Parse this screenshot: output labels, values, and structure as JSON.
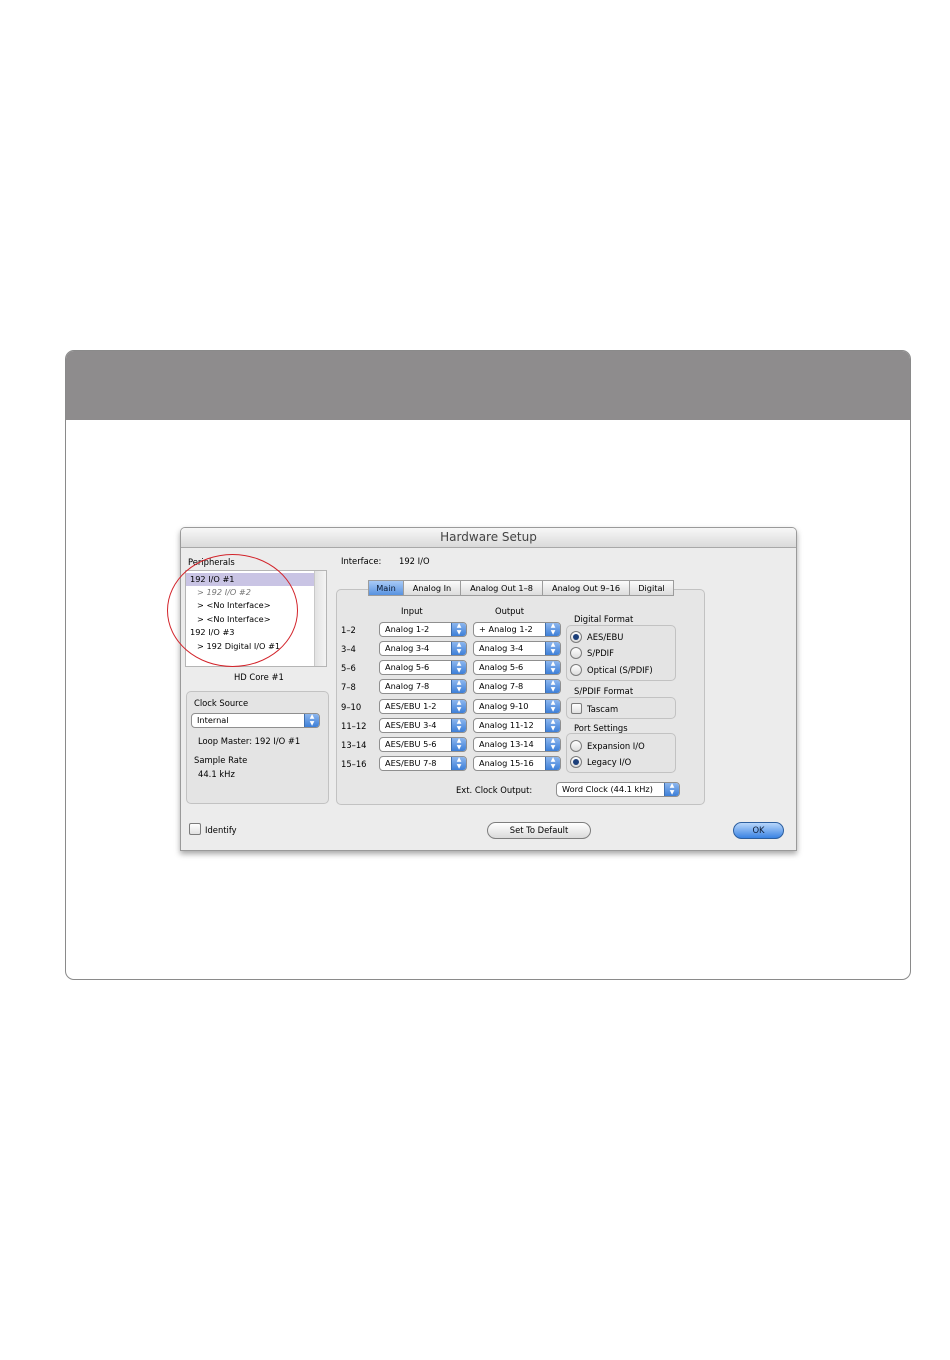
{
  "window": {
    "title": "Hardware Setup"
  },
  "peripherals": {
    "label": "Peripherals",
    "items": [
      {
        "label": "192 I/O #1"
      },
      {
        "label": "> 192 I/O #2"
      },
      {
        "label": "> <No Interface>"
      },
      {
        "label": "> <No Interface>"
      },
      {
        "label": "192 I/O #3"
      },
      {
        "label": "> 192 Digital I/O #1"
      }
    ],
    "core_label": "HD Core #1"
  },
  "clock": {
    "label": "Clock Source",
    "source_value": "Internal",
    "loop_master": "Loop Master: 192 I/O #1",
    "sample_rate_label": "Sample Rate",
    "sample_rate_value": "44.1 kHz"
  },
  "interface": {
    "label": "Interface:",
    "value": "192 I/O"
  },
  "tabs": [
    {
      "label": "Main"
    },
    {
      "label": "Analog In"
    },
    {
      "label": "Analog Out 1–8"
    },
    {
      "label": "Analog Out 9–16"
    },
    {
      "label": "Digital"
    }
  ],
  "io": {
    "input_header": "Input",
    "output_header": "Output",
    "rows": [
      {
        "channel": "1–2",
        "input": "Analog 1-2",
        "output": "+ Analog 1-2"
      },
      {
        "channel": "3–4",
        "input": "Analog 3-4",
        "output": "Analog 3-4"
      },
      {
        "channel": "5–6",
        "input": "Analog 5-6",
        "output": "Analog 5-6"
      },
      {
        "channel": "7–8",
        "input": "Analog 7-8",
        "output": "Analog 7-8"
      },
      {
        "channel": "9–10",
        "input": "AES/EBU 1-2",
        "output": "Analog 9-10"
      },
      {
        "channel": "11–12",
        "input": "AES/EBU 3-4",
        "output": "Analog 11-12"
      },
      {
        "channel": "13–14",
        "input": "AES/EBU 5-6",
        "output": "Analog 13-14"
      },
      {
        "channel": "15–16",
        "input": "AES/EBU 7-8",
        "output": "Analog 15-16"
      }
    ]
  },
  "digital_format": {
    "label": "Digital Format",
    "options": [
      {
        "label": "AES/EBU",
        "selected": true
      },
      {
        "label": "S/PDIF",
        "selected": false
      },
      {
        "label": "Optical (S/PDIF)",
        "selected": false
      }
    ]
  },
  "spdif_format": {
    "label": "S/PDIF Format",
    "tascam_label": "Tascam",
    "tascam_checked": false
  },
  "port_settings": {
    "label": "Port Settings",
    "options": [
      {
        "label": "Expansion I/O",
        "selected": false
      },
      {
        "label": "Legacy I/O",
        "selected": true
      }
    ]
  },
  "ext_clock": {
    "label": "Ext. Clock Output:",
    "value": "Word Clock (44.1 kHz)"
  },
  "footer": {
    "identify_label": "Identify",
    "set_default_label": "Set To Default",
    "ok_label": "OK"
  },
  "colors": {
    "selection": "#c9c4e4",
    "accent": "#5892e0",
    "annotation_circle": "#d2232a",
    "header_band": "#8e8c8d"
  }
}
